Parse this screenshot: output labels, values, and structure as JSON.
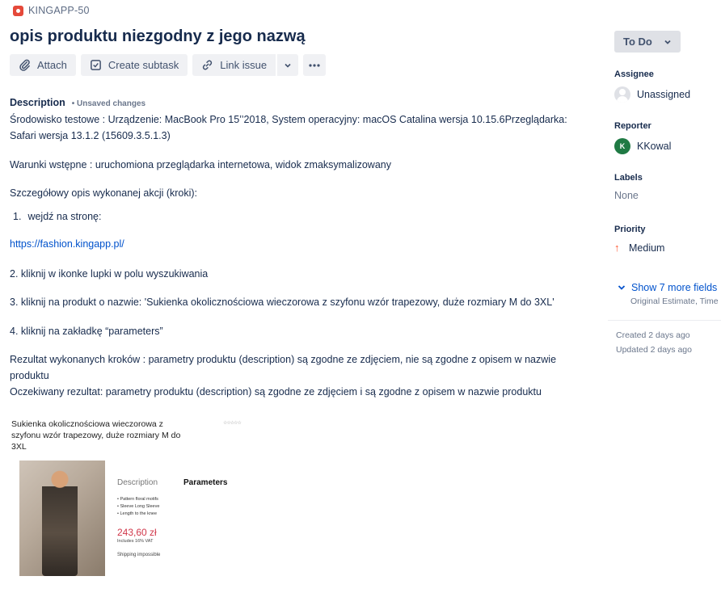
{
  "issue": {
    "key": "KINGAPP-50",
    "title": "opis produktu niezgodny z jego nazwą"
  },
  "toolbar": {
    "attach_label": "Attach",
    "create_subtask_label": "Create subtask",
    "link_issue_label": "Link issue"
  },
  "description": {
    "heading": "Description",
    "unsaved": "• Unsaved changes",
    "env_line1": "Środowisko testowe : Urządzenie: MacBook Pro 15’’2018, System operacyjny: macOS Catalina wersja 10.15.6Przeglądarka:",
    "env_line2": "Safari wersja 13.1.2 (15609.3.5.1.3)",
    "preconditions": "Warunki wstępne : uruchomiona przeglądarka internetowa, widok zmaksymalizowany",
    "steps_intro": "Szczegółowy opis wykonanej akcji (kroki):",
    "step1_num": "1.",
    "step1": "wejdź na stronę:",
    "link": "https://fashion.kingapp.pl/",
    "step2": "2. kliknij w ikonke lupki w polu wyszukiwania",
    "step3": "3. kliknij na produkt o nazwie: 'Sukienka okolicznościowa wieczorowa z szyfonu wzór trapezowy, duże rozmiary M do 3XL'",
    "step4": "4. kliknij na zakładkę “parameters”",
    "result_line1": "Rezultat wykonanych kroków : parametry produktu (description) są zgodne ze zdjęciem, nie są zgodne z opisem w nazwie",
    "result_line2": "produktu",
    "expected": "Oczekiwany rezultat: parametry produktu (description) są zgodne ze zdjęciem i są zgodne z opisem w nazwie produktu"
  },
  "screenshot": {
    "product_title": "Sukienka okolicznościowa wieczorowa z szyfonu wzór trapezowy, duże rozmiary M do 3XL",
    "tab_description": "Description",
    "tab_parameters": "Parameters",
    "bullets": [
      "Pattern floral motifs",
      "Sleeve Long Sleeve",
      "Length to the knee"
    ],
    "price": "243,60 zł",
    "vat": "Includes 16% VAT",
    "shipping": "Shipping impossible"
  },
  "sidebar": {
    "status": "To Do",
    "assignee_label": "Assignee",
    "assignee_value": "Unassigned",
    "reporter_label": "Reporter",
    "reporter_initial": "K",
    "reporter_value": "KKowal",
    "labels_label": "Labels",
    "labels_value": "None",
    "priority_label": "Priority",
    "priority_value": "Medium",
    "show_more": "Show 7 more fields",
    "show_more_sub": "Original Estimate, Time",
    "created": "Created 2 days ago",
    "updated": "Updated 2 days ago"
  },
  "colors": {
    "accent": "#0052cc",
    "bug": "#e5493a",
    "priority_medium": "#ff5630",
    "reporter_avatar": "#1f7a44"
  },
  "icons": [
    "bug-icon",
    "paperclip-icon",
    "subtask-icon",
    "link-icon",
    "chevron-down-icon",
    "more-icon",
    "person-icon",
    "arrow-up-icon"
  ]
}
